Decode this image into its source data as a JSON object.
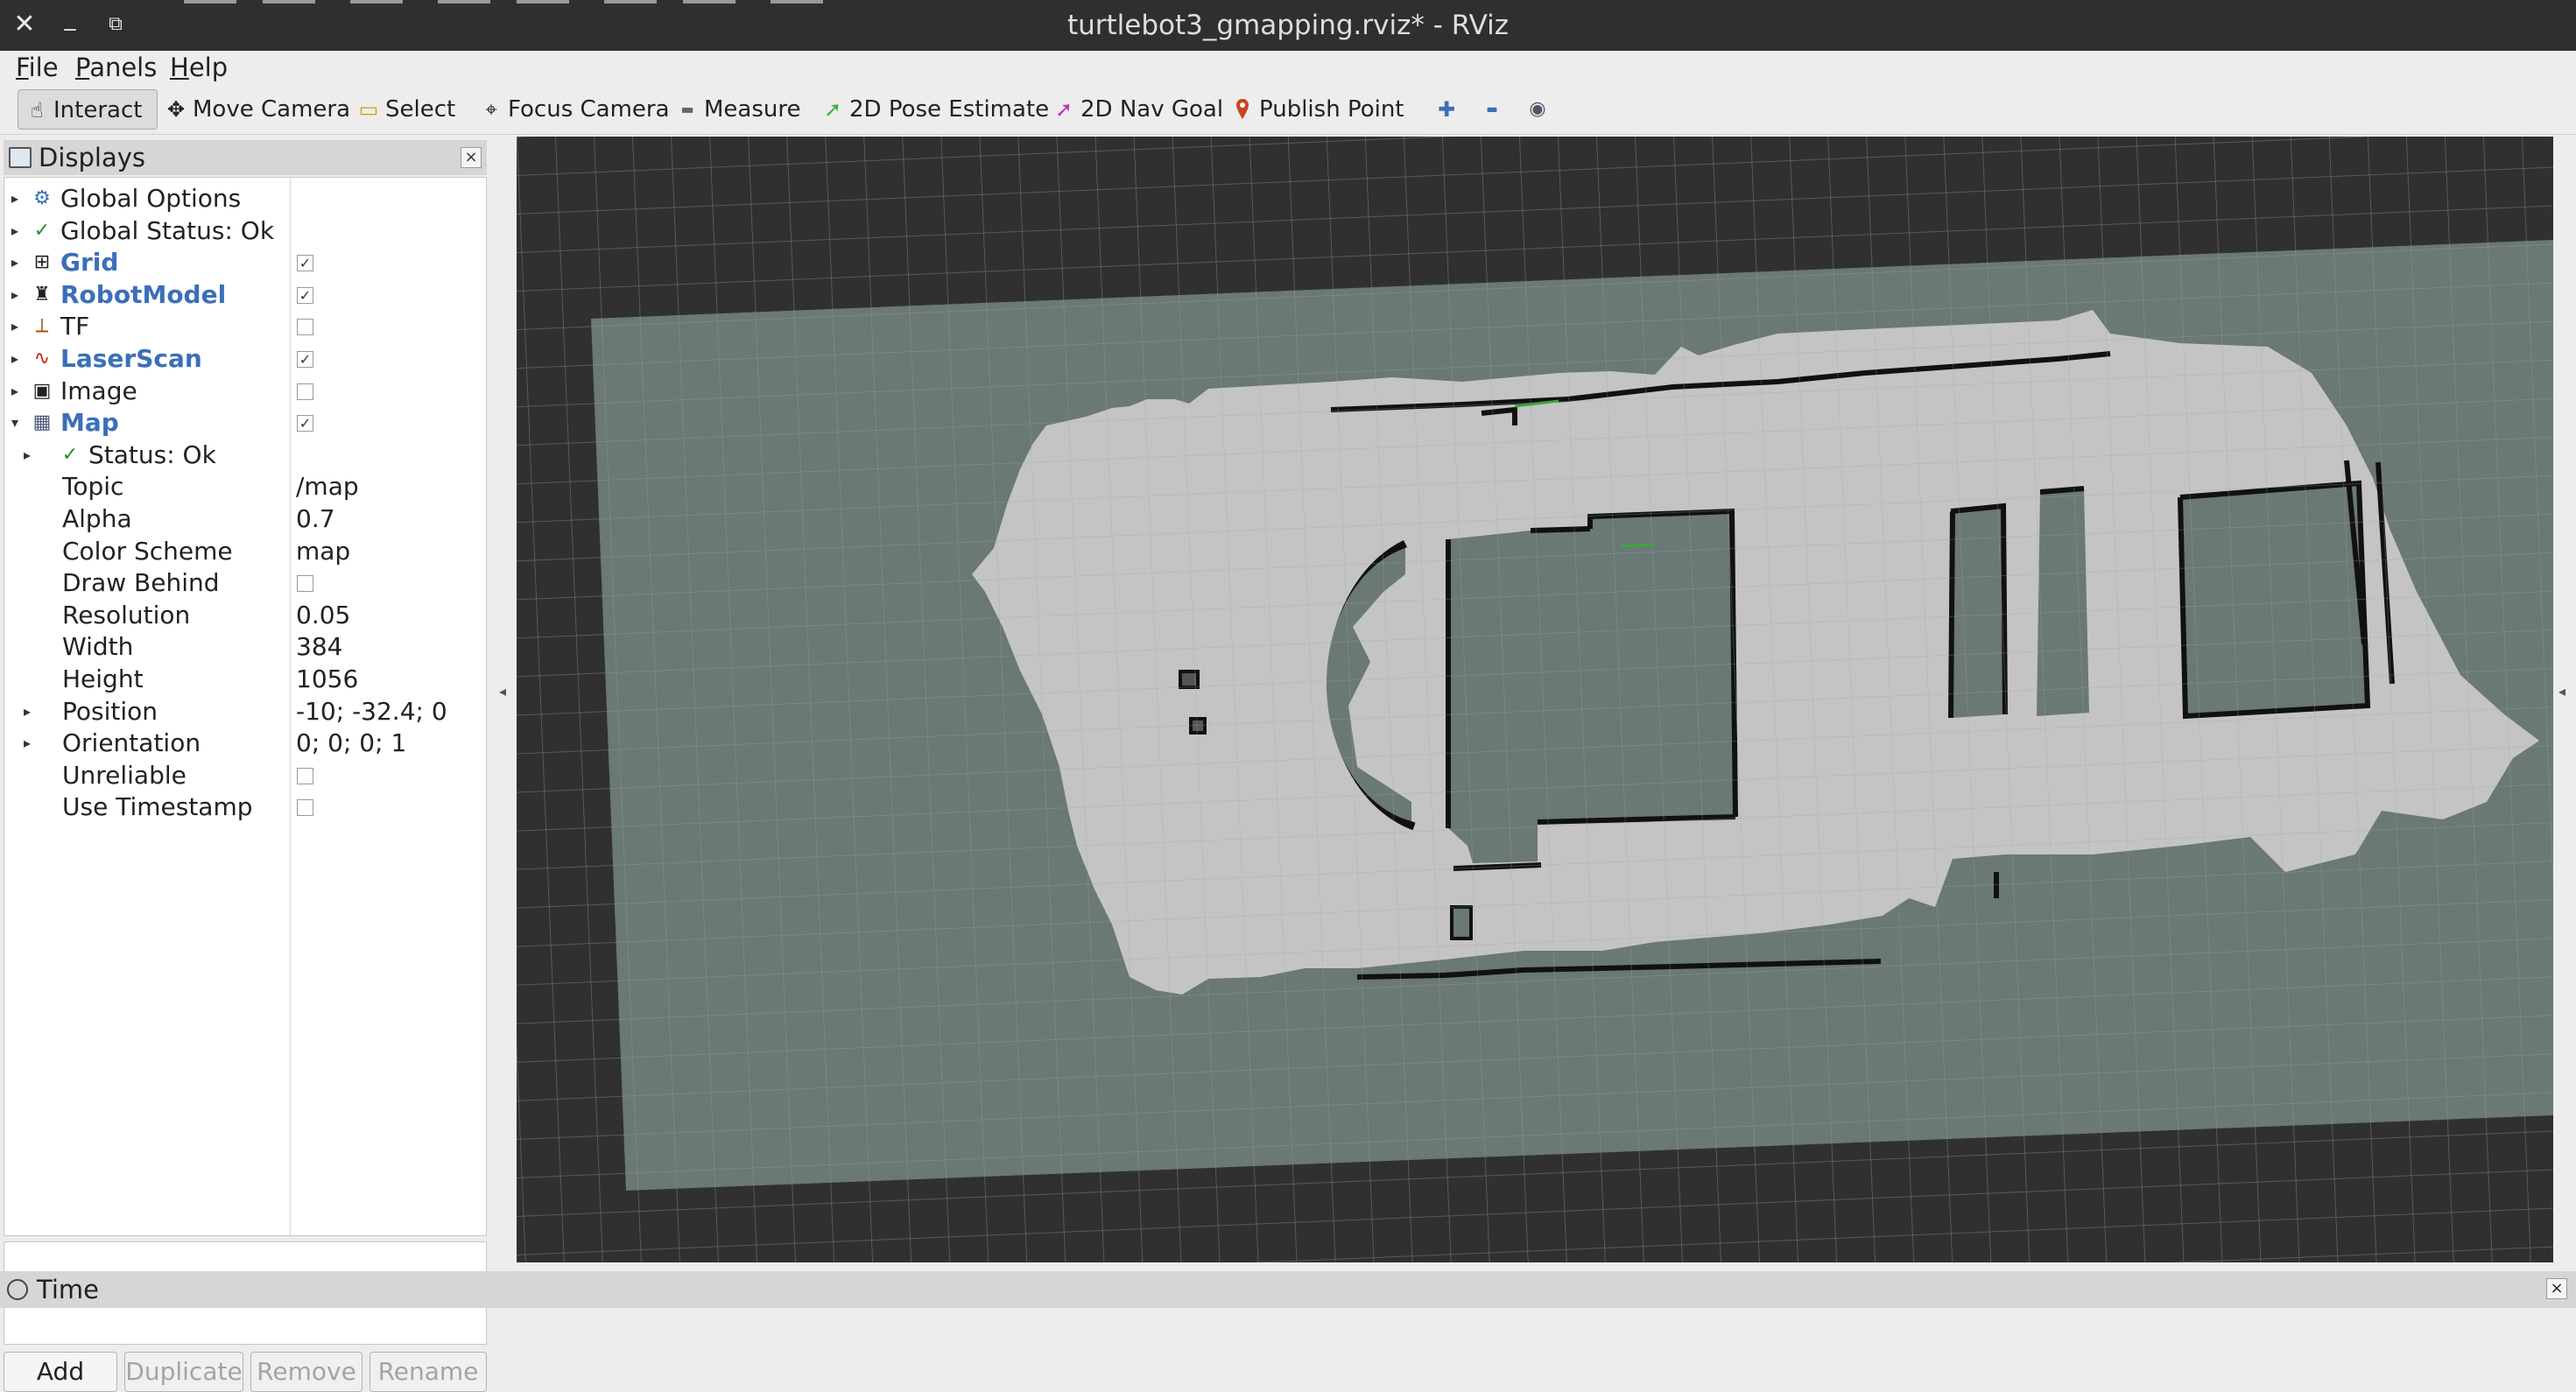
{
  "window": {
    "title": "turtlebot3_gmapping.rviz* - RViz",
    "close_glyph": "✕",
    "minimize_glyph": "_",
    "restore_glyph": "⧉"
  },
  "menubar": {
    "items": [
      {
        "label": "File",
        "key": "F",
        "rest": "ile"
      },
      {
        "label": "Panels",
        "key": "P",
        "rest": "anels"
      },
      {
        "label": "Help",
        "key": "H",
        "rest": "elp"
      }
    ]
  },
  "toolbar": {
    "tools": [
      {
        "label": "Interact",
        "icon": "hand-pointer-icon",
        "glyph": "☝",
        "active": true
      },
      {
        "label": "Move Camera",
        "icon": "move-camera-icon",
        "glyph": "✥"
      },
      {
        "label": "Select",
        "icon": "select-box-icon",
        "glyph": "▭"
      },
      {
        "label": "Focus Camera",
        "icon": "focus-camera-icon",
        "glyph": "⌖"
      },
      {
        "label": "Measure",
        "icon": "ruler-icon",
        "glyph": "▬"
      },
      {
        "label": "2D Pose Estimate",
        "icon": "green-arrow-icon",
        "glyph": "➚"
      },
      {
        "label": "2D Nav Goal",
        "icon": "magenta-arrow-icon",
        "glyph": "➚"
      },
      {
        "label": "Publish Point",
        "icon": "map-pin-icon",
        "glyph": "📍"
      }
    ],
    "extras": [
      {
        "icon": "add-tool-icon",
        "glyph": "✚"
      },
      {
        "icon": "remove-tool-icon",
        "glyph": "▬"
      },
      {
        "icon": "view-eye-icon",
        "glyph": "◉"
      }
    ]
  },
  "displays": {
    "header": "Displays",
    "close_glyph": "×",
    "rows": [
      {
        "name": "Global Options",
        "arrow": "▸",
        "icon": "global-options-icon",
        "glyph": "⚙",
        "style": "normal"
      },
      {
        "name": "Global Status: Ok",
        "arrow": "▸",
        "icon": "status-ok-check-icon",
        "glyph": "✓",
        "style": "normal"
      },
      {
        "name": "Grid",
        "arrow": "▸",
        "icon": "grid-icon",
        "glyph": "⊞",
        "style": "blue",
        "checked": true
      },
      {
        "name": "RobotModel",
        "arrow": "▸",
        "icon": "robot-model-icon",
        "glyph": "♜",
        "style": "blue",
        "checked": true
      },
      {
        "name": "TF",
        "arrow": "▸",
        "icon": "tf-axes-icon",
        "glyph": "⟂",
        "style": "normal",
        "checked": false
      },
      {
        "name": "LaserScan",
        "arrow": "▸",
        "icon": "laser-scan-icon",
        "glyph": "∿",
        "style": "blue",
        "checked": true
      },
      {
        "name": "Image",
        "arrow": "▸",
        "icon": "image-icon",
        "glyph": "▣",
        "style": "normal",
        "checked": false
      },
      {
        "name": "Map",
        "arrow": "▾",
        "icon": "map-icon",
        "glyph": "▦",
        "style": "blue",
        "checked": true
      },
      {
        "name": "Status: Ok",
        "arrow": "▸",
        "icon": "status-ok-check-icon",
        "glyph": "✓",
        "style": "normal",
        "indent": 1
      },
      {
        "name": "Topic",
        "value": "/map",
        "indent": 2
      },
      {
        "name": "Alpha",
        "value": "0.7",
        "indent": 2
      },
      {
        "name": "Color Scheme",
        "value": "map",
        "indent": 2
      },
      {
        "name": "Draw Behind",
        "indent": 2,
        "checked": false
      },
      {
        "name": "Resolution",
        "value": "0.05",
        "indent": 2
      },
      {
        "name": "Width",
        "value": "384",
        "indent": 2
      },
      {
        "name": "Height",
        "value": "1056",
        "indent": 2
      },
      {
        "name": "Position",
        "value": "-10; -32.4; 0",
        "indent": 2,
        "arrow": "▸"
      },
      {
        "name": "Orientation",
        "value": "0; 0; 0; 1",
        "indent": 2,
        "arrow": "▸"
      },
      {
        "name": "Unreliable",
        "indent": 2,
        "checked": false
      },
      {
        "name": "Use Timestamp",
        "indent": 2,
        "checked": false
      }
    ],
    "buttons": {
      "add": "Add",
      "duplicate": "Duplicate",
      "remove": "Remove",
      "rename": "Rename"
    }
  },
  "timepanel": {
    "label": "Time",
    "close_glyph": "×"
  },
  "colors": {
    "viewport_background": "#303030",
    "map_unknown": "#6a7876",
    "map_free": "#c3c3c3",
    "map_occupied": "#111111",
    "grid_line": "#8a8a8a",
    "blue_display_name": "#3b6fba"
  }
}
